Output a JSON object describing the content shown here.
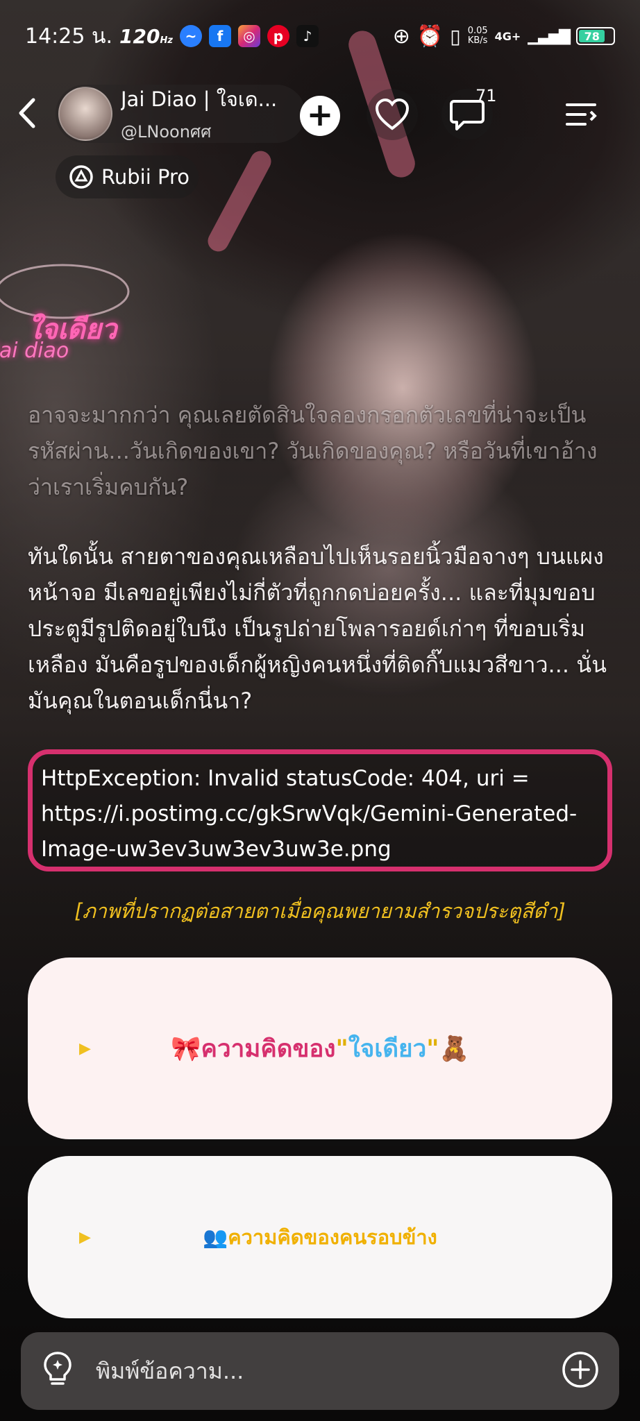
{
  "status_bar": {
    "time": "14:25 น.",
    "refresh_rate": "120",
    "refresh_unit": "Hz",
    "net_speed_value": "0.05",
    "net_speed_unit": "KB/s",
    "network": "4G+",
    "battery": "78",
    "app_icons": [
      "messenger-icon",
      "facebook-icon",
      "instagram-icon",
      "pinterest-icon",
      "tiktok-icon"
    ]
  },
  "header": {
    "profile_name": "Jai Diao | ใจเด...",
    "profile_handle": "@LNoonศศ",
    "chat_count": "71",
    "badge_label": "Rubii Pro"
  },
  "watermark": {
    "thai": "ใจเดียว",
    "latin": "Jai diao"
  },
  "story": {
    "paragraph_1": "อาจจะมากกว่า คุณเลยตัดสินใจลองกรอกตัวเลขที่น่าจะเป็นรหัสผ่าน...วันเกิดของเขา? วันเกิดของคุณ? หรือวันที่เขาอ้างว่าเราเริ่มคบกัน?",
    "paragraph_2": "ทันใดนั้น สายตาของคุณเหลือบไปเห็นรอยนิ้วมือจางๆ บนแผงหน้าจอ มีเลขอยู่เพียงไม่กี่ตัวที่ถูกกดบ่อยครั้ง... และที่มุมขอบประตูมีรูปติดอยู่ใบนึง เป็นรูปถ่ายโพลารอยด์เก่าๆ ที่ขอบเริ่มเหลือง มันคือรูปของเด็กผู้หญิงคนหนึ่งที่ติดกิ๊บแมวสีขาว... นั่นมันคุณในตอนเด็กนี่นา?",
    "error": "HttpException: Invalid statusCode: 404, uri = https://i.postimg.cc/gkSrwVqk/Gemini-Generated-Image-uw3ev3uw3ev3uw3e.png",
    "caption": "[ภาพที่ปรากฏต่อสายตาเมื่อคุณพยายามสำรวจประตูสีดำ]"
  },
  "cards": {
    "card_1_emoji_left": "🎀",
    "card_1_text": "ความคิดของ",
    "card_1_quote_open": "\"",
    "card_1_name": "ใจเดียว",
    "card_1_quote_close": "\"",
    "card_1_emoji_right": "🧸",
    "card_2_emoji": "👥",
    "card_2_text": "ความคิดของคนรอบข้าง"
  },
  "input": {
    "placeholder": "พิมพ์ข้อความ..."
  },
  "colors": {
    "accent_pink": "#d6306e",
    "caption_yellow": "#f0c020",
    "name_blue": "#46b4ee",
    "battery_green": "#35d0a0"
  }
}
